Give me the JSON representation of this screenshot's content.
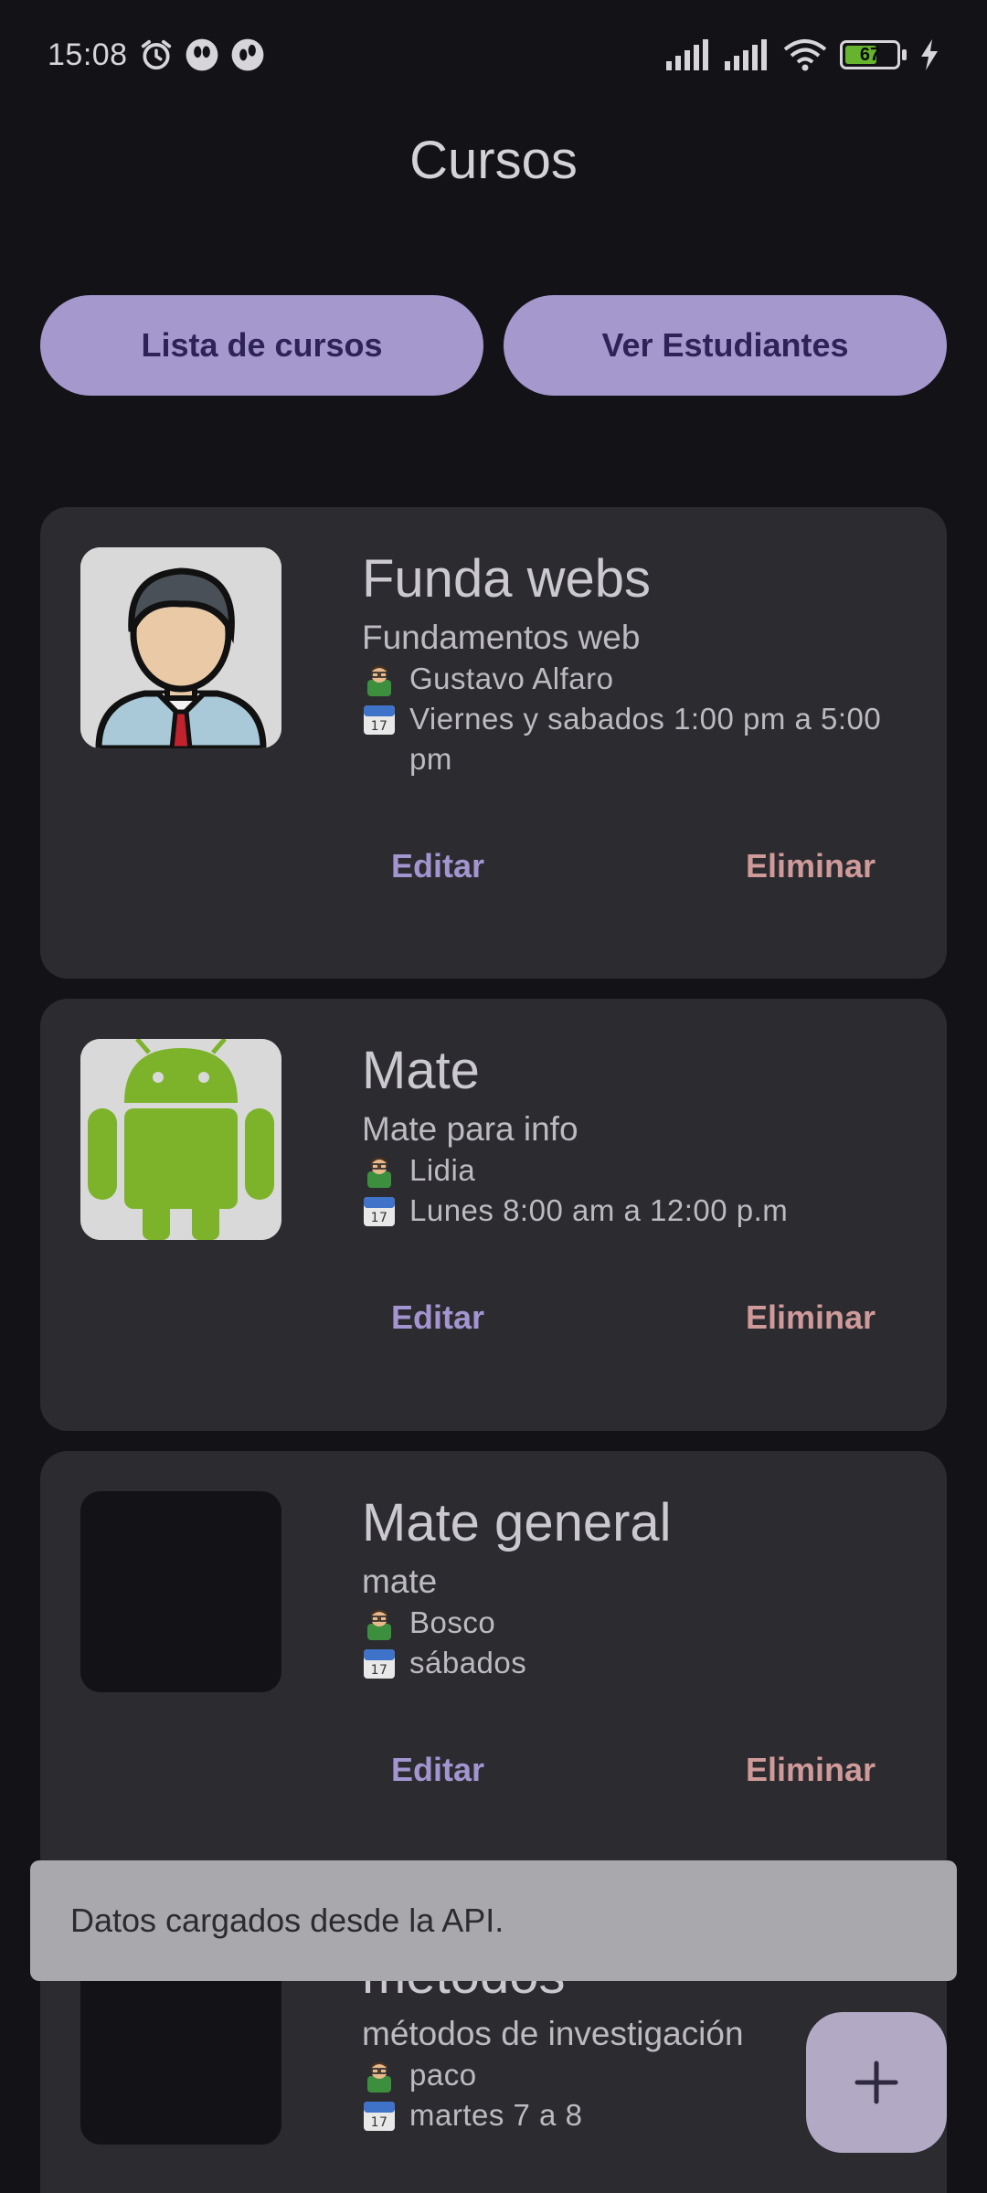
{
  "status_bar": {
    "time": "15:08",
    "battery_level": 67,
    "battery_text": "67"
  },
  "header": {
    "title": "Cursos"
  },
  "actions": {
    "list_label": "Lista de cursos",
    "students_label": "Ver Estudiantes"
  },
  "courses": [
    {
      "name": "Funda webs",
      "description": "Fundamentos web",
      "teacher": "Gustavo Alfaro",
      "schedule": "Viernes y sabados 1:00 pm a 5:00 pm",
      "thumbnail_icon": "teacher-avatar-icon",
      "edit_label": "Editar",
      "delete_label": "Eliminar"
    },
    {
      "name": "Mate",
      "description": "Mate para info",
      "teacher": "Lidia",
      "schedule": "Lunes 8:00 am a 12:00 p.m",
      "thumbnail_icon": "android-icon",
      "edit_label": "Editar",
      "delete_label": "Eliminar"
    },
    {
      "name": "Mate general",
      "description": "mate",
      "teacher": "Bosco",
      "schedule": "sábados",
      "thumbnail_icon": "empty-thumbnail",
      "edit_label": "Editar",
      "delete_label": "Eliminar"
    },
    {
      "name": "métodos",
      "description": "métodos de investigación",
      "teacher": "paco",
      "schedule": "martes 7 a 8",
      "thumbnail_icon": "empty-thumbnail"
    }
  ],
  "snackbar": {
    "message": "Datos cargados desde la API."
  },
  "fab": {
    "icon": "plus-icon"
  },
  "colors": {
    "background": "#131217",
    "card": "#2c2b30",
    "primary_button": "#a598cd",
    "edit": "#a395cf",
    "delete": "#cf9a99",
    "snackbar": "#a9a8ad",
    "fab": "#b2a9c5"
  }
}
